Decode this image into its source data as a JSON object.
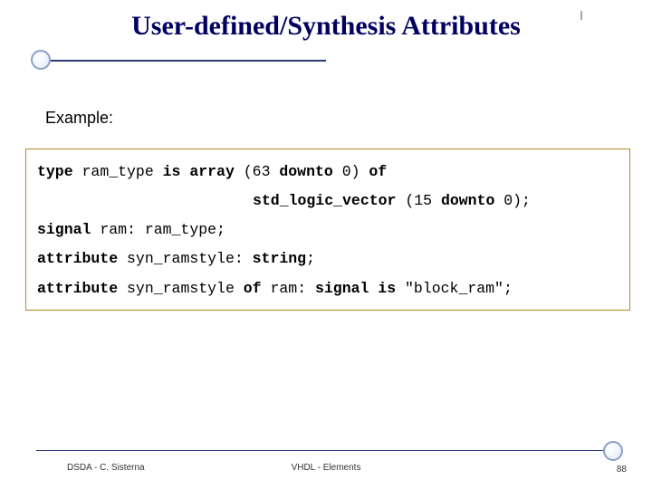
{
  "title": "User-defined/Synthesis Attributes",
  "example_label": "Example:",
  "code": {
    "l1a": "type ",
    "l1b": "ram_type ",
    "l1c": "is array ",
    "l1d": "(63 ",
    "l1e": "downto ",
    "l1f": "0) ",
    "l1g": "of",
    "l2a": "std_logic_vector ",
    "l2b": "(15 ",
    "l2c": "downto ",
    "l2d": "0);",
    "l3a": "signal ",
    "l3b": "ram: ram_type;",
    "l4a": "attribute ",
    "l4b": "syn_ramstyle: ",
    "l4c": "string",
    "l4d": ";",
    "l5a": "attribute ",
    "l5b": "syn_ramstyle ",
    "l5c": "of ",
    "l5d": "ram: ",
    "l5e": "signal is ",
    "l5f": "\"block_ram\";"
  },
  "footer": {
    "left": "DSDA - C. Sisterna",
    "center": "VHDL - Elements",
    "page": "88"
  }
}
